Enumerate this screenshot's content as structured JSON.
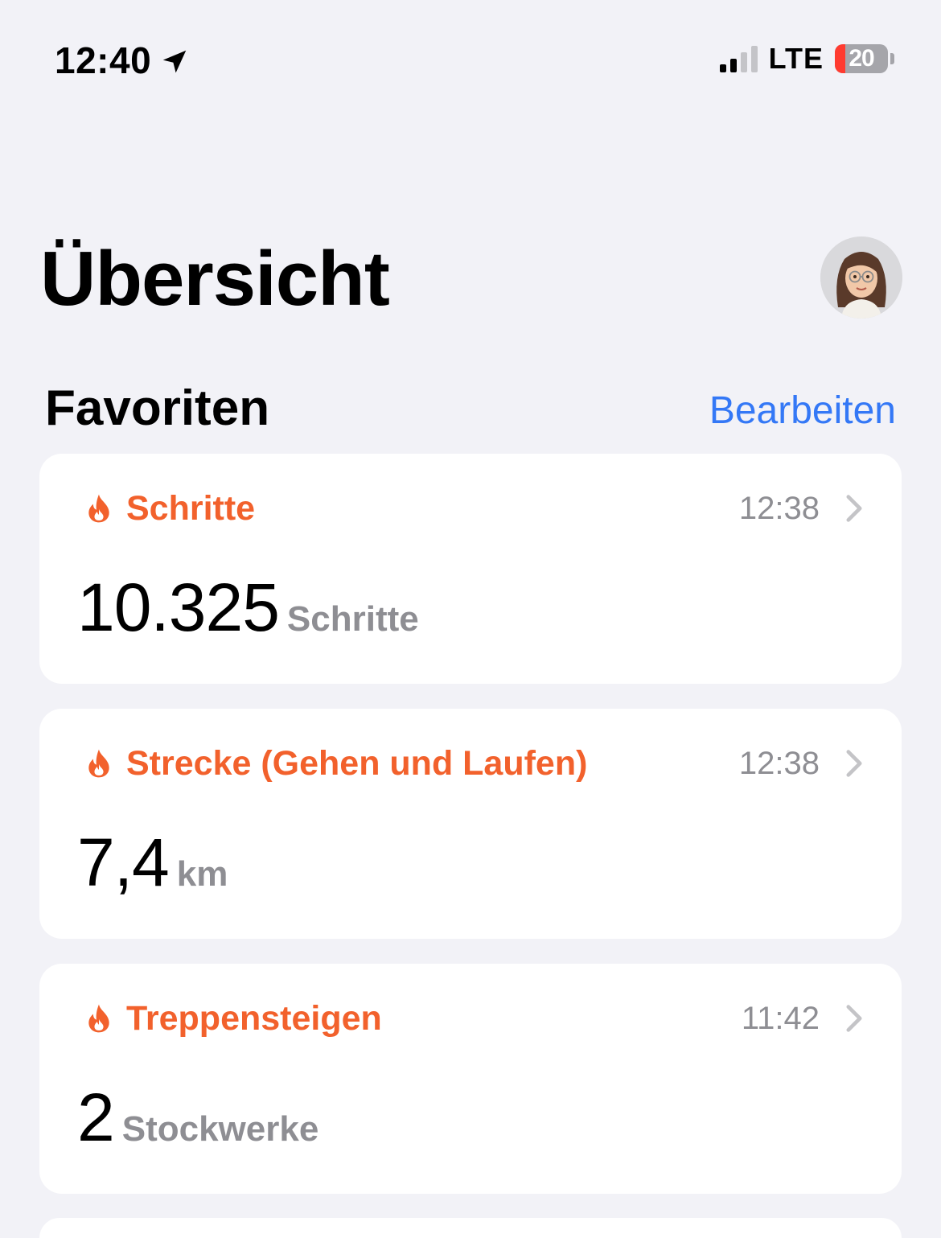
{
  "status_bar": {
    "time": "12:40",
    "network": "LTE",
    "battery": {
      "label": "20",
      "level_percent": 20
    },
    "signal_bars_active": 2,
    "signal_bars_total": 4
  },
  "header": {
    "title": "Übersicht"
  },
  "favorites": {
    "title": "Favoriten",
    "edit_label": "Bearbeiten",
    "cards": [
      {
        "title": "Schritte",
        "time": "12:38",
        "value": "10.325",
        "unit": "Schritte"
      },
      {
        "title": "Strecke (Gehen und Laufen)",
        "time": "12:38",
        "value": "7,4",
        "unit": "km"
      },
      {
        "title": "Treppensteigen",
        "time": "11:42",
        "value": "2",
        "unit": "Stockwerke"
      }
    ]
  },
  "colors": {
    "accent_orange": "#f2612c",
    "link_blue": "#3478f6",
    "background": "#f2f2f7",
    "secondary_text": "#8e8e93",
    "battery_low": "#ff3b30"
  },
  "icons": {
    "location": "location-arrow-icon",
    "card": "flame-icon",
    "disclosure": "chevron-right-icon"
  }
}
